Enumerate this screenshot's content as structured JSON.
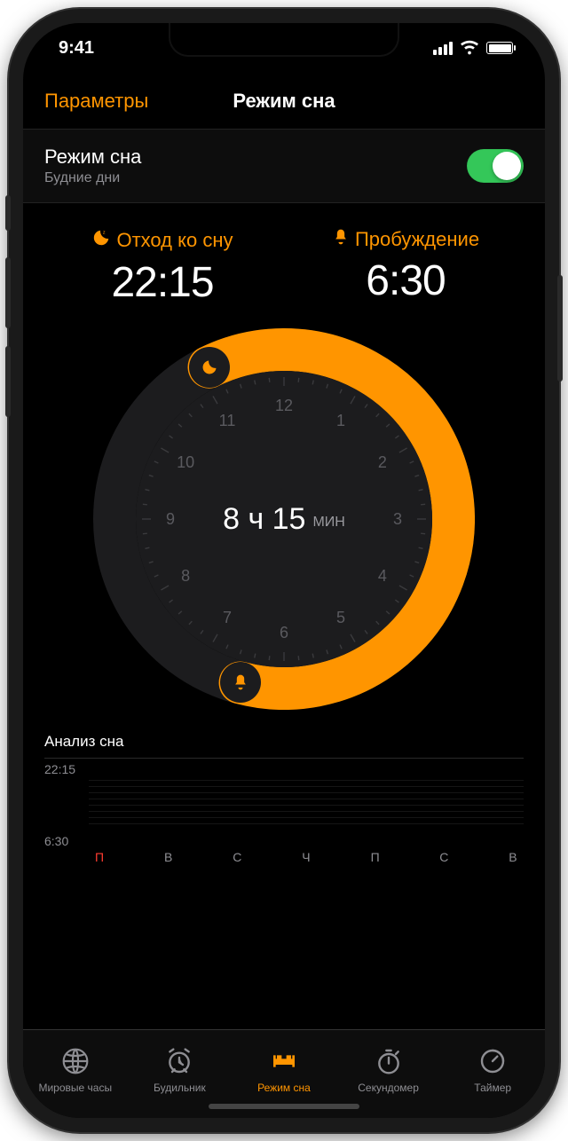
{
  "status": {
    "time": "9:41"
  },
  "nav": {
    "left": "Параметры",
    "title": "Режим сна"
  },
  "sleep_mode": {
    "label": "Режим сна",
    "sublabel": "Будние дни",
    "enabled": true
  },
  "bedtime": {
    "label": "Отход ко сну",
    "value": "22:15"
  },
  "wake": {
    "label": "Пробуждение",
    "value": "6:30"
  },
  "duration": {
    "main": "8 ч 15",
    "suffix": "МИН"
  },
  "clock": {
    "numbers": [
      "12",
      "1",
      "2",
      "3",
      "4",
      "5",
      "6",
      "7",
      "8",
      "9",
      "10",
      "11"
    ],
    "bedtime_angle_deg": 333.75,
    "wake_angle_deg": 195,
    "bedtime_clock_minutes": 1335,
    "wake_clock_minutes": 390
  },
  "analysis": {
    "title": "Анализ сна",
    "top_label": "22:15",
    "bottom_label": "6:30",
    "days": [
      {
        "short": "П",
        "active": true
      },
      {
        "short": "В",
        "active": false
      },
      {
        "short": "С",
        "active": false
      },
      {
        "short": "Ч",
        "active": false
      },
      {
        "short": "П",
        "active": false
      },
      {
        "short": "С",
        "active": false
      },
      {
        "short": "В",
        "active": false
      }
    ]
  },
  "tabs": {
    "world": "Мировые часы",
    "alarm": "Будильник",
    "bedtime": "Режим сна",
    "stopwatch": "Секундомер",
    "timer": "Таймер",
    "active_index": 2
  },
  "colors": {
    "accent": "#ff9500",
    "green": "#34c759"
  }
}
